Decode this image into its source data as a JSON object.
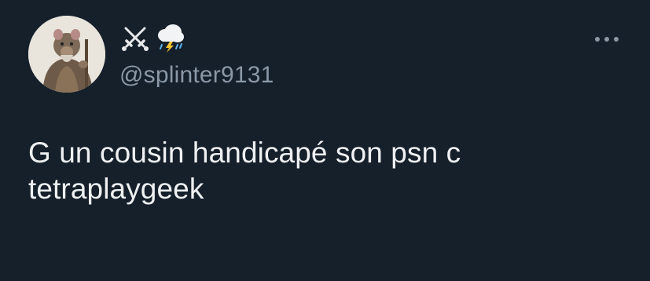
{
  "author": {
    "display_name_glyphs": [
      "crossed-swords-icon",
      "cloud-with-lightning-and-rain-icon"
    ],
    "handle": "@splinter9131"
  },
  "tweet": {
    "text_lines": [
      "G un cousin handicapé son psn c",
      "tetraplaygeek"
    ]
  },
  "colors": {
    "background": "#15202b",
    "text_primary": "#e7e9ea",
    "text_secondary": "#8b98a5",
    "link": "#1d9bf0"
  },
  "icons": {
    "more": "more-horizontal-icon",
    "avatar": "avatar-image"
  }
}
